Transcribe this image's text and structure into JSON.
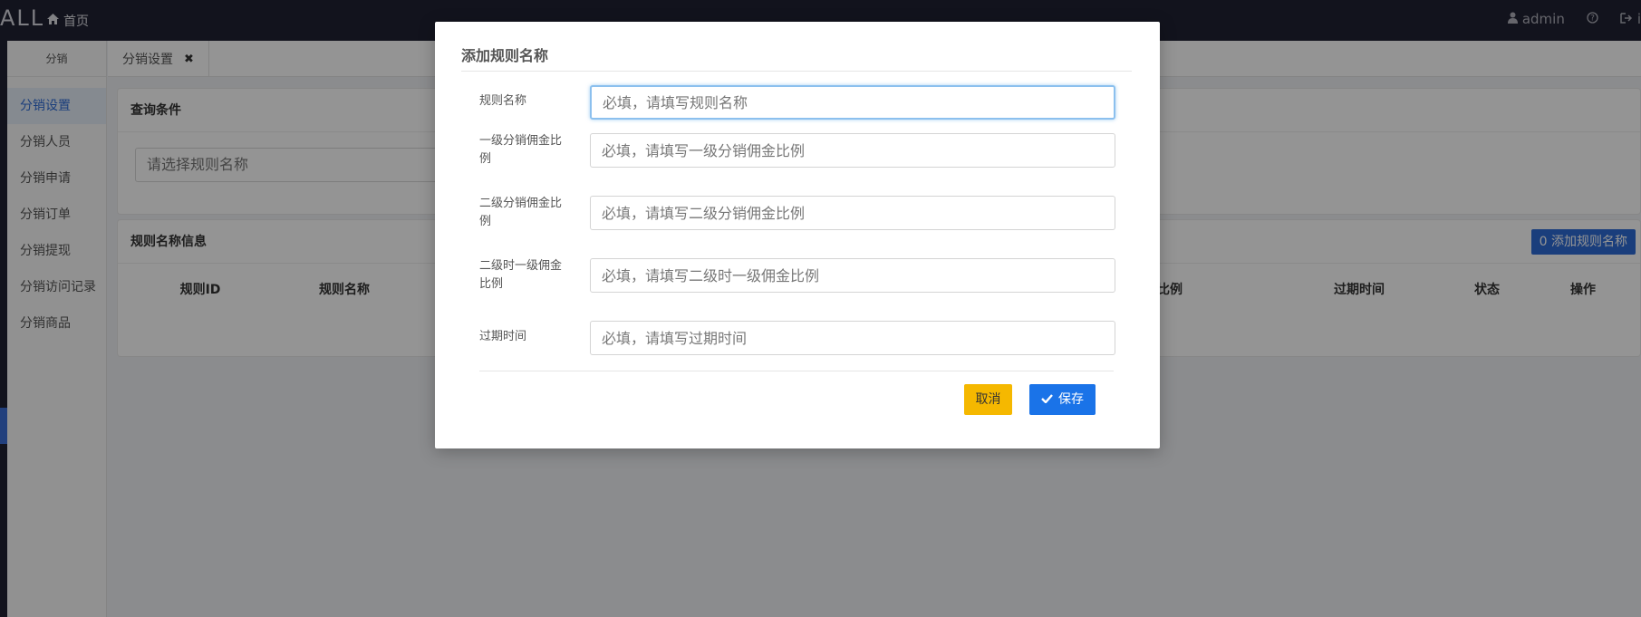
{
  "topbar": {
    "logo": "ALL",
    "home_label": "首页",
    "user": "admin",
    "extra": "i"
  },
  "sidebar": {
    "header": "分销",
    "items": [
      {
        "label": "分销设置",
        "active": true
      },
      {
        "label": "分销人员"
      },
      {
        "label": "分销申请"
      },
      {
        "label": "分销订单"
      },
      {
        "label": "分销提现"
      },
      {
        "label": "分销访问记录"
      },
      {
        "label": "分销商品"
      }
    ]
  },
  "tabs": [
    {
      "label": "分销设置",
      "close": "✖"
    }
  ],
  "query": {
    "title": "查询条件",
    "select_placeholder": "请选择规则名称"
  },
  "list": {
    "title": "规则名称信息",
    "add_button": "0 添加规则名称",
    "columns": [
      "规则ID",
      "规则名称",
      "比例",
      "过期时间",
      "状态",
      "操作"
    ]
  },
  "modal": {
    "title": "添加规则名称",
    "fields": [
      {
        "label": "规则名称",
        "placeholder": "必填，请填写规则名称"
      },
      {
        "label": "一级分销佣金比例",
        "placeholder": "必填，请填写一级分销佣金比例"
      },
      {
        "label": "二级分销佣金比例",
        "placeholder": "必填，请填写二级分销佣金比例"
      },
      {
        "label": "二级时一级佣金比例",
        "placeholder": "必填，请填写二级时一级佣金比例"
      },
      {
        "label": "过期时间",
        "placeholder": "必填，请填写过期时间"
      }
    ],
    "cancel_label": "取消",
    "save_label": "保存"
  },
  "colors": {
    "topbar_bg": "#1f2233",
    "primary": "#1a73e8",
    "warning": "#f5b800",
    "active_menu": "#2d6bd6"
  },
  "icons": [
    "home-icon",
    "user-icon",
    "help-icon",
    "logout-icon",
    "close-icon",
    "check-icon"
  ]
}
